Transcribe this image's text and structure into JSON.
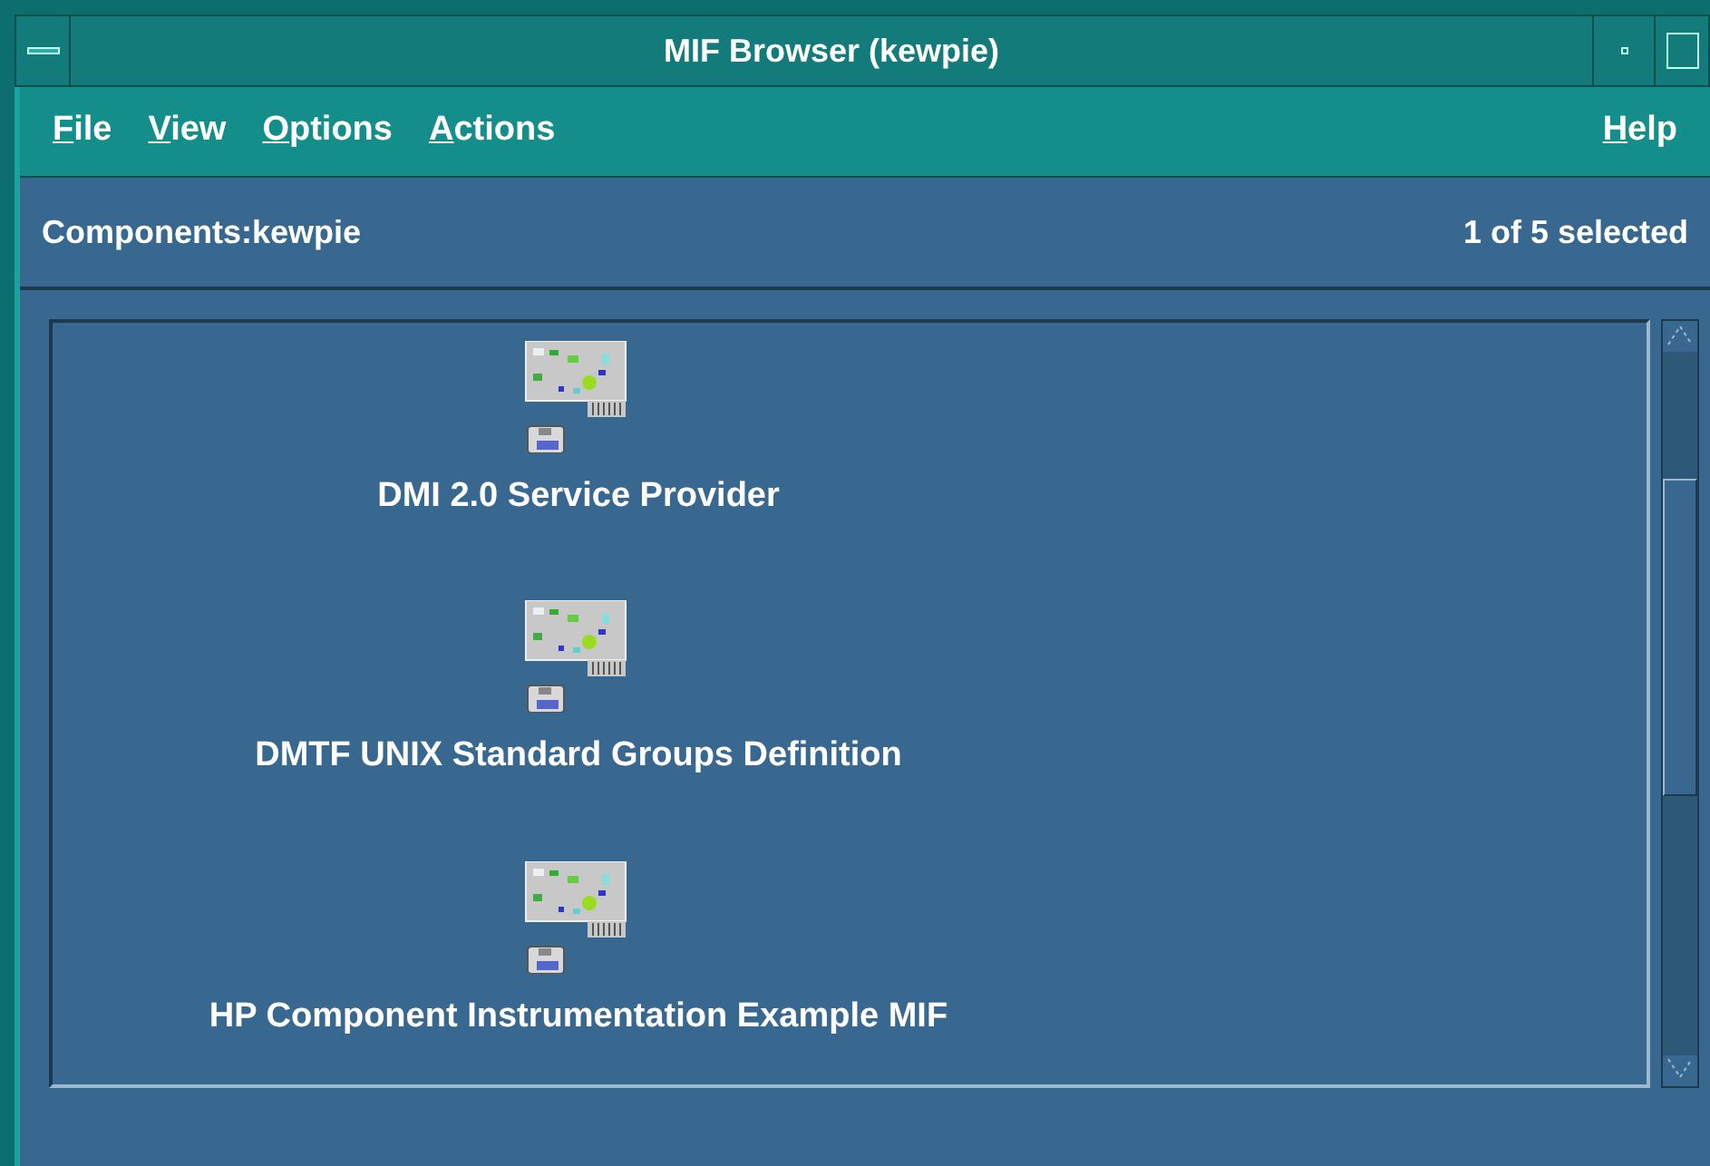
{
  "window": {
    "title": "MIF Browser (kewpie)"
  },
  "menu": {
    "left": [
      "File",
      "View",
      "Options",
      "Actions"
    ],
    "right": "Help"
  },
  "header": {
    "title": "Components:kewpie",
    "status": "1 of 5 selected"
  },
  "components": [
    {
      "label": "DMI 2.0 Service Provider",
      "selected": false
    },
    {
      "label": "DMTF UNIX Standard Groups Definition",
      "selected": false
    },
    {
      "label": "HP Component Instrumentation Example MIF",
      "selected": false
    }
  ]
}
